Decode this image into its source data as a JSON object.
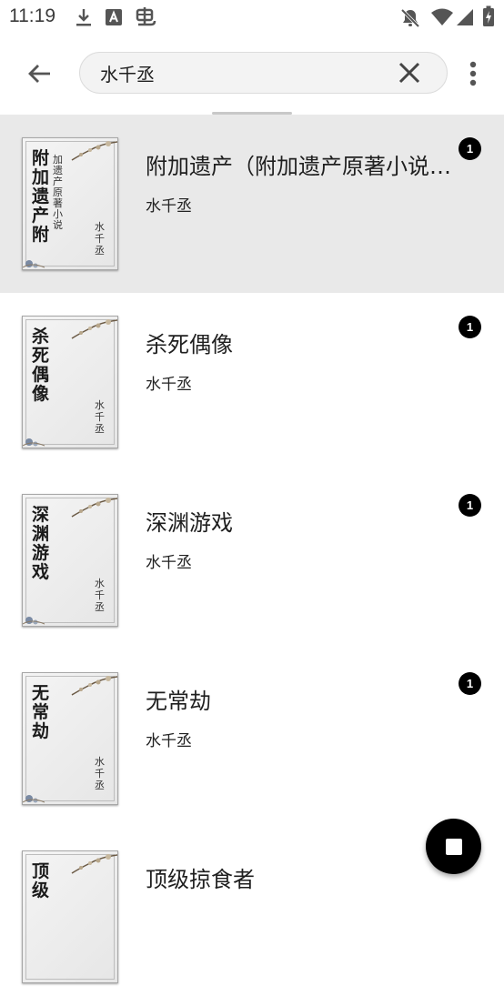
{
  "status_bar": {
    "time": "11:19"
  },
  "search": {
    "query": "水千丞"
  },
  "colors": {
    "selected_row": "#e9e9e9",
    "badge": "#000000",
    "fab": "#000000"
  },
  "results": [
    {
      "title": "附加遗产（附加遗产原著小说…",
      "author": "水千丞",
      "badge": "1",
      "cover": {
        "title": "附加遗产附",
        "subtitle": "加遗产原著小说",
        "author": "水千丞"
      }
    },
    {
      "title": "杀死偶像",
      "author": "水千丞",
      "badge": "1",
      "cover": {
        "title": "杀死偶像",
        "subtitle": "",
        "author": "水千丞"
      }
    },
    {
      "title": "深渊游戏",
      "author": "水千丞",
      "badge": "1",
      "cover": {
        "title": "深渊游戏",
        "subtitle": "",
        "author": "水千丞"
      }
    },
    {
      "title": "无常劫",
      "author": "水千丞",
      "badge": "1",
      "cover": {
        "title": "无常劫",
        "subtitle": "",
        "author": "水千丞"
      }
    },
    {
      "title": "顶级掠食者",
      "author": "",
      "badge": "",
      "cover": {
        "title": "顶级",
        "subtitle": "",
        "author": ""
      }
    }
  ]
}
